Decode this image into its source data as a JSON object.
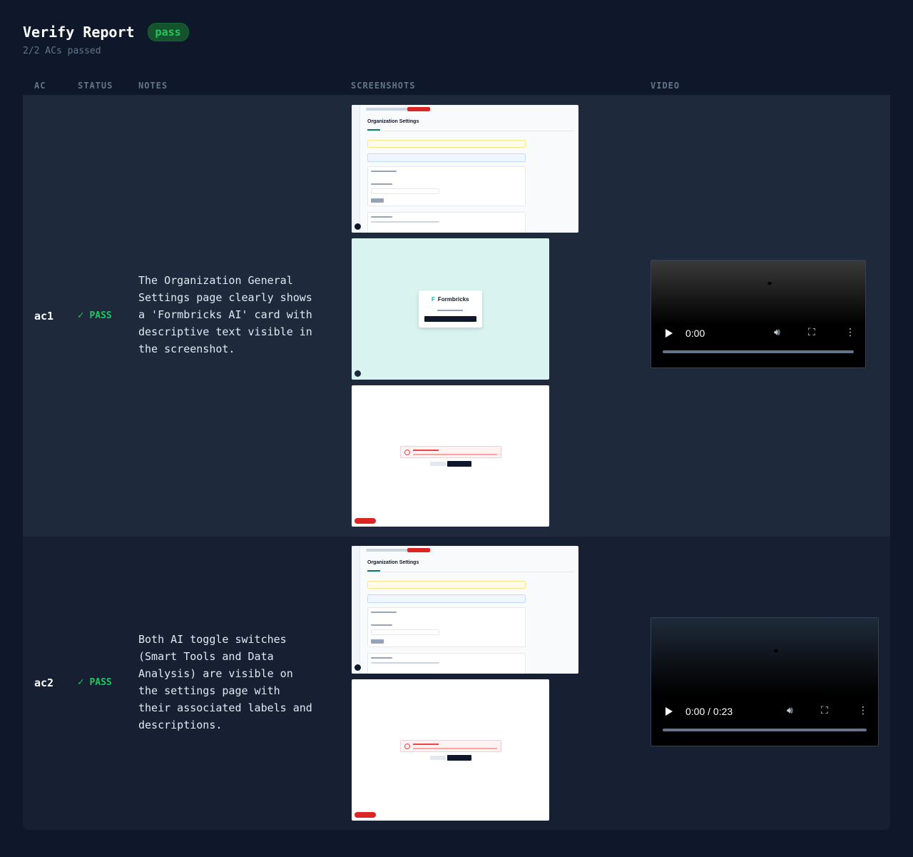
{
  "header": {
    "title": "Verify Report",
    "badge": "pass",
    "subtitle": "2/2 ACs passed"
  },
  "columns": {
    "ac": "AC",
    "status": "STATUS",
    "notes": "NOTES",
    "screenshots": "SCREENSHOTS",
    "video": "VIDEO"
  },
  "rows": [
    {
      "ac": "ac1",
      "status_icon": "✓",
      "status": "PASS",
      "notes": "The Organization General\nSettings page clearly shows\na 'Formbricks AI' card with\ndescriptive text visible in\nthe screenshot.",
      "screenshots": [
        {
          "heading": "Organization Settings"
        },
        {
          "logo": "Formbricks"
        },
        {
          "kind": "error"
        }
      ],
      "video": {
        "time": "0:00"
      }
    },
    {
      "ac": "ac2",
      "status_icon": "✓",
      "status": "PASS",
      "notes": "Both AI toggle switches\n(Smart Tools and Data\nAnalysis) are visible on\nthe settings page with\ntheir associated labels and\ndescriptions.",
      "screenshots": [
        {
          "heading": "Organization Settings"
        },
        {
          "kind": "error"
        }
      ],
      "video": {
        "time": "0:00 / 0:23"
      }
    }
  ],
  "colors": {
    "background": "#0f172a",
    "row_primary": "#1e293b",
    "pass_green": "#22c55e"
  },
  "icons": {
    "status": "check-icon",
    "play": "play-icon",
    "volume": "volume-icon",
    "fullscreen": "fullscreen-icon",
    "menu": "more-vertical-icon"
  }
}
